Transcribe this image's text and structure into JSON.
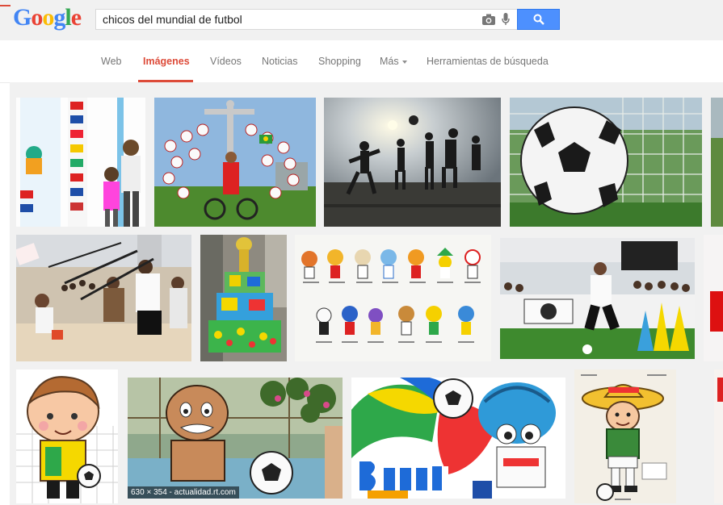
{
  "search": {
    "query": "chicos del mundial de futbol"
  },
  "logo": {
    "letters": [
      "G",
      "o",
      "o",
      "g",
      "l",
      "e"
    ],
    "colors": [
      "#4285f4",
      "#ea4335",
      "#fbbc05",
      "#4285f4",
      "#34a853",
      "#ea4335"
    ]
  },
  "nav": {
    "tabs": [
      "Web",
      "Imágenes",
      "Vídeos",
      "Noticias",
      "Shopping",
      "Más",
      "Herramientas de búsqueda"
    ],
    "active": "Imágenes"
  },
  "results": {
    "hover_caption": "630 × 354 - actualidad.rt.com"
  },
  "colors": {
    "accent": "#dd4b39",
    "button": "#4d90fe"
  }
}
